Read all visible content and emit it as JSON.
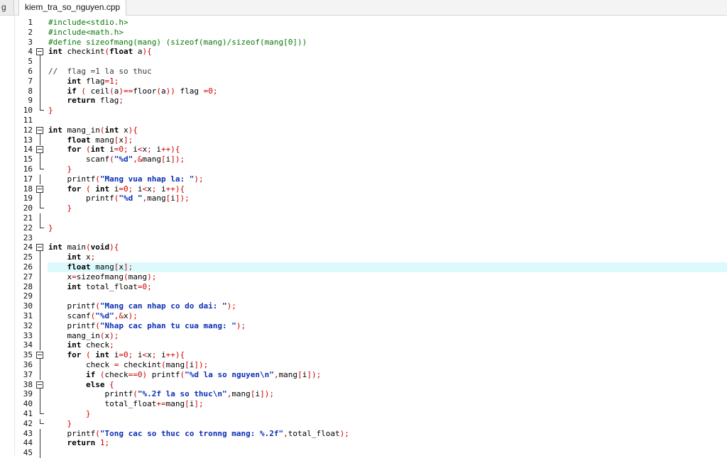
{
  "tabs": {
    "stub_label": "g",
    "active_label": "kiem_tra_so_nguyen.cpp"
  },
  "editor": {
    "highlight_line": 26,
    "lines": [
      {
        "n": "1",
        "fold": "",
        "code": "#include<stdio.h>"
      },
      {
        "n": "2",
        "fold": "",
        "code": "#include<math.h>"
      },
      {
        "n": "3",
        "fold": "",
        "code": "#define sizeofmang(mang) (sizeof(mang)/sizeof(mang[0]))"
      },
      {
        "n": "4",
        "fold": "open",
        "code": "int checkint(float a){"
      },
      {
        "n": "5",
        "fold": "line",
        "code": ""
      },
      {
        "n": "6",
        "fold": "line",
        "code": "//  flag =1 la so thuc"
      },
      {
        "n": "7",
        "fold": "line",
        "code": "    int flag=1;"
      },
      {
        "n": "8",
        "fold": "line",
        "code": "    if ( ceil(a)==floor(a)) flag =0;"
      },
      {
        "n": "9",
        "fold": "line",
        "code": "    return flag;"
      },
      {
        "n": "10",
        "fold": "end",
        "code": "}"
      },
      {
        "n": "11",
        "fold": "",
        "code": ""
      },
      {
        "n": "12",
        "fold": "open",
        "code": "int mang_in(int x){"
      },
      {
        "n": "13",
        "fold": "line",
        "code": "    float mang[x];"
      },
      {
        "n": "14",
        "fold": "open",
        "code": "    for (int i=0; i<x; i++){"
      },
      {
        "n": "15",
        "fold": "line",
        "code": "        scanf(\"%d\",&mang[i]);"
      },
      {
        "n": "16",
        "fold": "end",
        "code": "    }"
      },
      {
        "n": "17",
        "fold": "line",
        "code": "    printf(\"Mang vua nhap la: \");"
      },
      {
        "n": "18",
        "fold": "open",
        "code": "    for ( int i=0; i<x; i++){"
      },
      {
        "n": "19",
        "fold": "line",
        "code": "        printf(\"%d \",mang[i]);"
      },
      {
        "n": "20",
        "fold": "end",
        "code": "    }"
      },
      {
        "n": "21",
        "fold": "line",
        "code": ""
      },
      {
        "n": "22",
        "fold": "end",
        "code": "}"
      },
      {
        "n": "23",
        "fold": "",
        "code": ""
      },
      {
        "n": "24",
        "fold": "open",
        "code": "int main(void){"
      },
      {
        "n": "25",
        "fold": "line",
        "code": "    int x;"
      },
      {
        "n": "26",
        "fold": "line",
        "code": "    float mang[x];"
      },
      {
        "n": "27",
        "fold": "line",
        "code": "    x=sizeofmang(mang);"
      },
      {
        "n": "28",
        "fold": "line",
        "code": "    int total_float=0;"
      },
      {
        "n": "29",
        "fold": "line",
        "code": ""
      },
      {
        "n": "30",
        "fold": "line",
        "code": "    printf(\"Mang can nhap co do dai: \");"
      },
      {
        "n": "31",
        "fold": "line",
        "code": "    scanf(\"%d\",&x);"
      },
      {
        "n": "32",
        "fold": "line",
        "code": "    printf(\"Nhap cac phan tu cua mang: \");"
      },
      {
        "n": "33",
        "fold": "line",
        "code": "    mang_in(x);"
      },
      {
        "n": "34",
        "fold": "line",
        "code": "    int check;"
      },
      {
        "n": "35",
        "fold": "open",
        "code": "    for ( int i=0; i<x; i++){"
      },
      {
        "n": "36",
        "fold": "line",
        "code": "        check = checkint(mang[i]);"
      },
      {
        "n": "37",
        "fold": "line",
        "code": "        if (check==0) printf(\"%d la so nguyen\\n\",mang[i]);"
      },
      {
        "n": "38",
        "fold": "open",
        "code": "        else {"
      },
      {
        "n": "39",
        "fold": "line",
        "code": "            printf(\"%.2f la so thuc\\n\",mang[i]);"
      },
      {
        "n": "40",
        "fold": "line",
        "code": "            total_float+=mang[i];"
      },
      {
        "n": "41",
        "fold": "end",
        "code": "        }"
      },
      {
        "n": "42",
        "fold": "end",
        "code": "    }"
      },
      {
        "n": "43",
        "fold": "line",
        "code": "    printf(\"Tong cac so thuc co tronng mang: %.2f\",total_float);"
      },
      {
        "n": "44",
        "fold": "line",
        "code": "    return 1;"
      },
      {
        "n": "45",
        "fold": "line",
        "code": ""
      }
    ]
  }
}
